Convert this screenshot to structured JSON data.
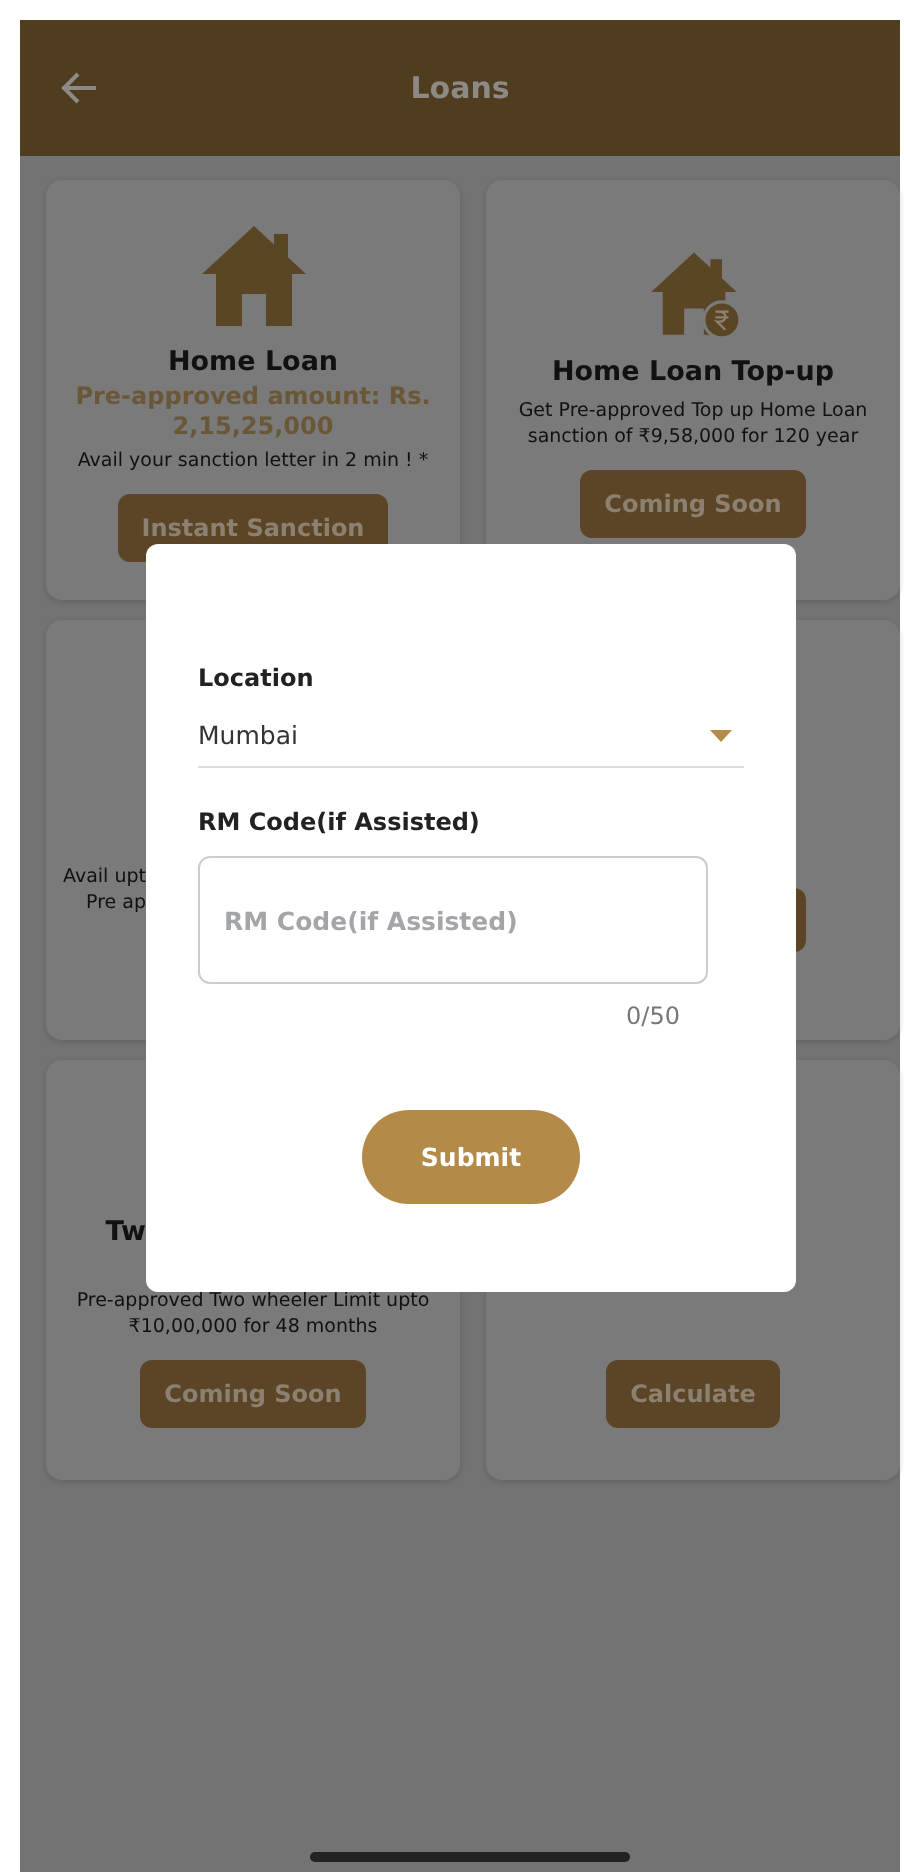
{
  "header": {
    "title": "Loans"
  },
  "cards": [
    {
      "items": [
        {
          "kind": "house_icon"
        },
        {
          "kind": "title",
          "text": "Home Loan"
        },
        {
          "kind": "amount",
          "text": "Pre-approved amount: Rs. 2,15,25,000"
        },
        {
          "kind": "text",
          "text": "Avail your sanction letter in 2 min ! *"
        },
        {
          "kind": "button",
          "text": "Instant Sanction"
        }
      ]
    },
    {
      "items": [
        {
          "kind": "house_rupee_icon"
        },
        {
          "kind": "title",
          "text": "Home Loan Top-up"
        },
        {
          "kind": "text",
          "text": "Get Pre-approved Top up Home Loan sanction of ₹9,58,000 for 120 year"
        },
        {
          "kind": "button",
          "text": "Coming Soon"
        }
      ]
    },
    {
      "items": [
        {
          "kind": "fragment",
          "text": "Avail upt"
        },
        {
          "kind": "fragment",
          "text": "Pre ap"
        }
      ]
    },
    {
      "items": [
        {
          "kind": "covered_button"
        }
      ]
    },
    {
      "items": [
        {
          "kind": "fragment_title",
          "text": "Tw"
        },
        {
          "kind": "text",
          "text": "Pre-approved Two wheeler Limit upto ₹10,00,000 for 48 months"
        },
        {
          "kind": "button",
          "text": "Coming Soon"
        }
      ]
    },
    {
      "items": [
        {
          "kind": "button",
          "text": "Calculate"
        }
      ]
    }
  ],
  "dialog": {
    "location": {
      "label": "Location",
      "value": "Mumbai"
    },
    "rm_code": {
      "label": "RM Code(if Assisted)",
      "placeholder": "RM Code(if Assisted)",
      "counter": "0/50"
    },
    "submit": "Submit"
  }
}
